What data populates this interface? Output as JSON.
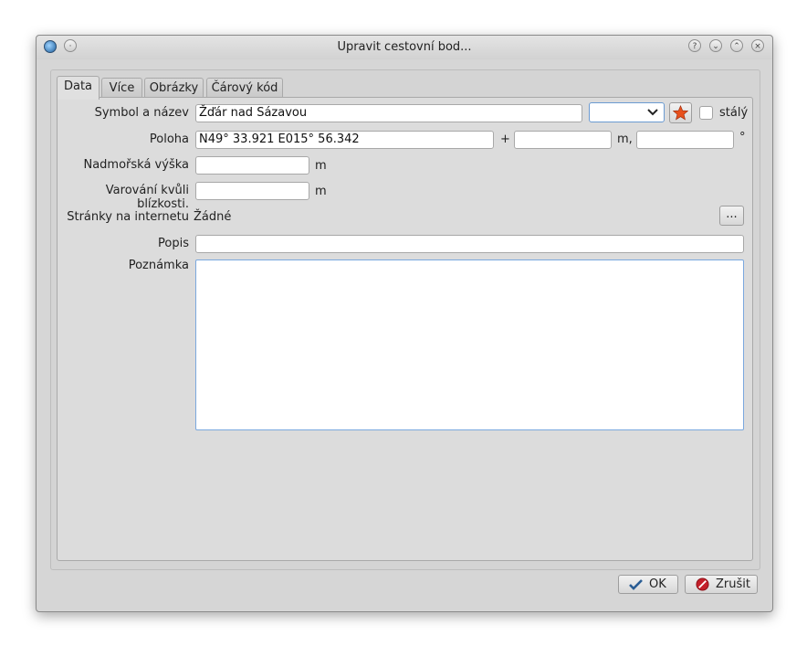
{
  "window": {
    "title": "Upravit cestovní bod...",
    "title_buttons": [
      {
        "name": "help-icon",
        "glyph": "?"
      },
      {
        "name": "minimize-icon",
        "glyph": "⌄"
      },
      {
        "name": "maximize-icon",
        "glyph": "⌃"
      },
      {
        "name": "close-icon",
        "glyph": "×"
      }
    ]
  },
  "tabs": [
    {
      "label": "Data",
      "active": true
    },
    {
      "label": "Více",
      "active": false
    },
    {
      "label": "Obrázky",
      "active": false
    },
    {
      "label": "Čárový kód",
      "active": false
    }
  ],
  "form": {
    "symbol_label": "Symbol a název",
    "name_value": "Žďár nad Sázavou",
    "permanent_label": "stálý",
    "position_label": "Poloha",
    "position_value": "N49° 33.921 E015° 56.342",
    "position_plus": "+",
    "position_unit_m": "m,",
    "position_unit_deg": "°",
    "altitude_label": "Nadmořská výška",
    "altitude_unit": "m",
    "proximity_label": "Varování kvůli blízkosti.",
    "proximity_unit": "m",
    "website_label": "Stránky na internetu",
    "website_value": "Žádné",
    "website_button": "...",
    "description_label": "Popis",
    "note_label": "Poznámka"
  },
  "buttons": {
    "ok": "OK",
    "cancel": "Zrušit"
  },
  "colors": {
    "focus_border": "#7aa8de",
    "ok_icon": "#2a5d94",
    "cancel_icon": "#c4202a",
    "star_icon": "#e8501c"
  }
}
